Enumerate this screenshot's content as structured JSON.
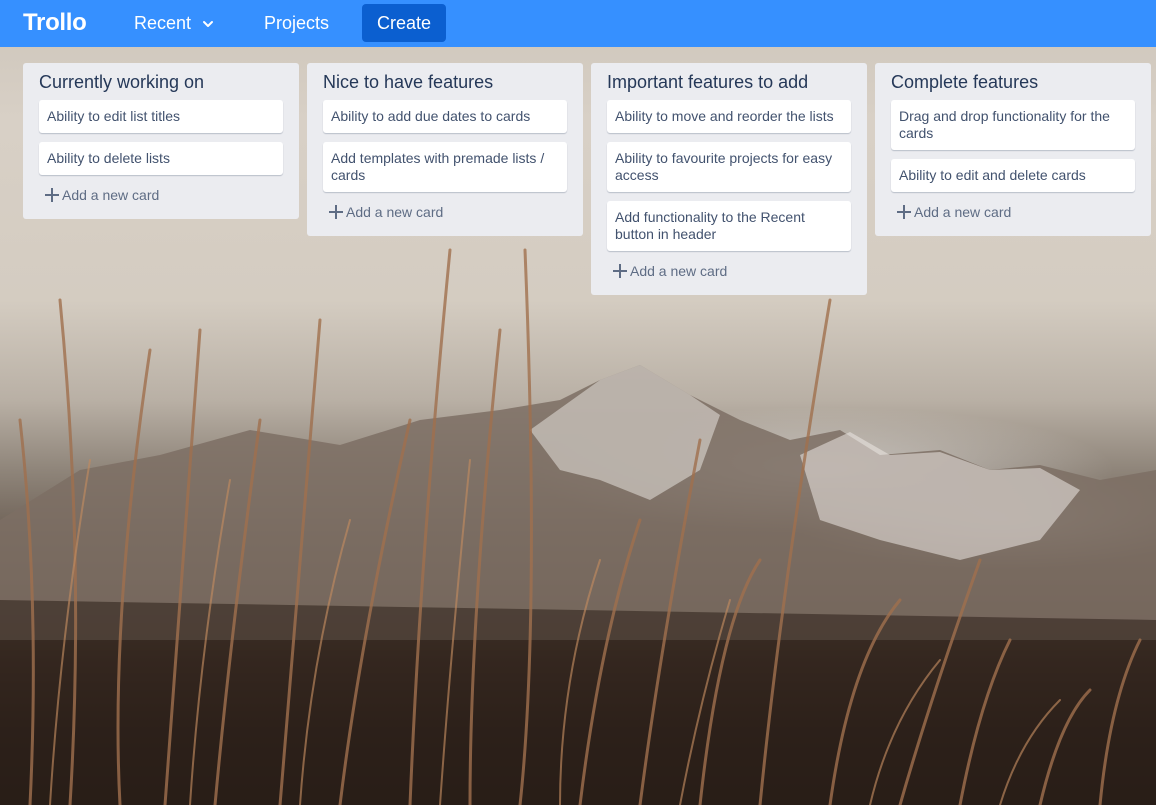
{
  "header": {
    "logo": "Trollo",
    "recent_label": "Recent",
    "projects_label": "Projects",
    "create_label": "Create",
    "background_color": "#3690ff",
    "create_button_color": "#0b5fd0"
  },
  "lists": [
    {
      "title": "Currently working on",
      "cards": [
        "Ability to edit list titles",
        "Ability to delete lists"
      ],
      "add_card_label": "Add a new card"
    },
    {
      "title": "Nice to have features",
      "cards": [
        "Ability to add due dates to cards",
        "Add templates with premade lists / cards"
      ],
      "add_card_label": "Add a new card"
    },
    {
      "title": "Important features to add",
      "cards": [
        "Ability to move and reorder the lists",
        "Ability to favourite projects for easy access",
        "Add functionality to the Recent button in header"
      ],
      "add_card_label": "Add a new card"
    },
    {
      "title": "Complete features",
      "cards": [
        "Drag and drop functionality for the cards",
        "Ability to edit and delete cards"
      ],
      "add_card_label": "Add a new card"
    }
  ],
  "icons": {
    "recent_dropdown": "chevron-down-icon",
    "add_card": "plus-icon"
  },
  "list_background_color": "#ebecf0",
  "background_image": "mountains-and-grass-photo"
}
